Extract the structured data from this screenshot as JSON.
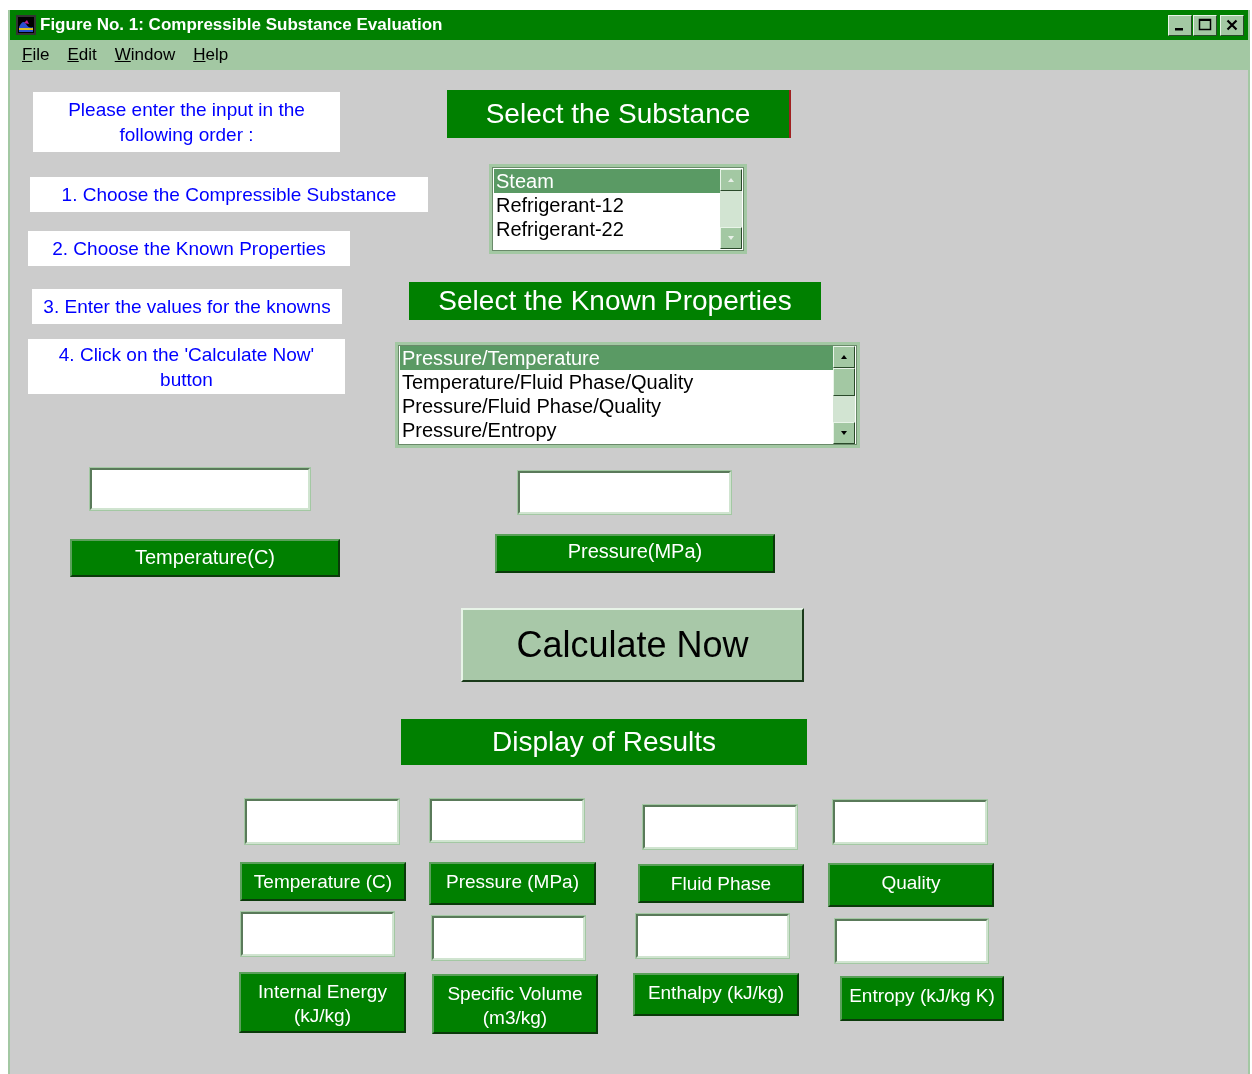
{
  "window": {
    "title": "Figure No. 1: Compressible Substance Evaluation"
  },
  "menu": [
    {
      "label": "File"
    },
    {
      "label": "Edit"
    },
    {
      "label": "Window"
    },
    {
      "label": "Help"
    }
  ],
  "instructions": [
    "Please enter the input  in the following order :",
    "1. Choose the Compressible Substance",
    "2. Choose the Known Properties",
    "3. Enter the values for the knowns",
    "4. Click on the 'Calculate Now' button"
  ],
  "substance_header": "Select the Substance",
  "substance_list": [
    {
      "label": "Steam",
      "selected": true
    },
    {
      "label": "Refrigerant-12",
      "selected": false
    },
    {
      "label": "Refrigerant-22",
      "selected": false
    }
  ],
  "known_header": "Select the Known Properties",
  "known_list": [
    {
      "label": "Pressure/Temperature",
      "selected": true
    },
    {
      "label": "Temperature/Fluid Phase/Quality",
      "selected": false
    },
    {
      "label": "Pressure/Fluid Phase/Quality",
      "selected": false
    },
    {
      "label": "Pressure/Entropy",
      "selected": false
    }
  ],
  "inputs": [
    {
      "label": "Temperature(C)"
    },
    {
      "label": "Pressure(MPa)"
    }
  ],
  "calculate_button": "Calculate Now",
  "results_header": "Display of Results",
  "results": [
    {
      "label": "Temperature (C)"
    },
    {
      "label": "Pressure (MPa)"
    },
    {
      "label": "Fluid Phase"
    },
    {
      "label": "Quality"
    },
    {
      "label": "Internal Energy (kJ/kg)"
    },
    {
      "label": "Specific Volume (m3/kg)"
    },
    {
      "label": "Enthalpy (kJ/kg)"
    },
    {
      "label": "Entropy (kJ/kg K)"
    }
  ]
}
